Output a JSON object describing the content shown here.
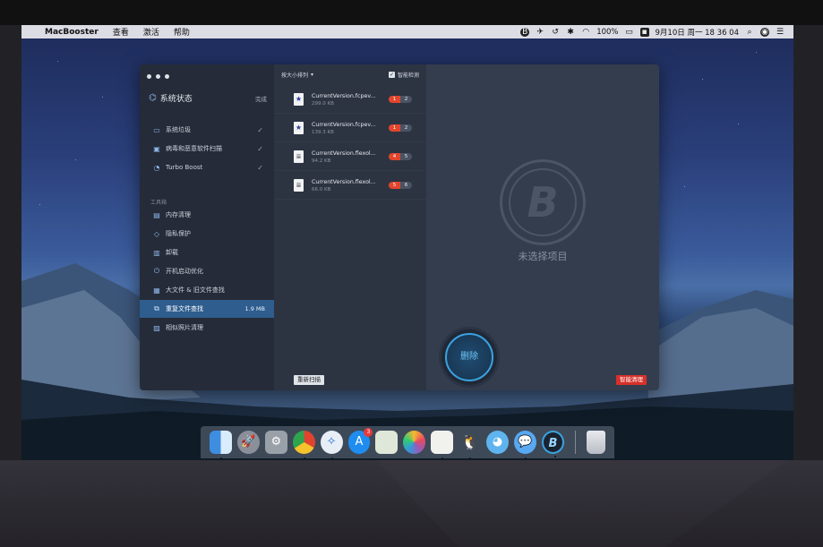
{
  "menubar": {
    "app_name": "MacBooster",
    "menus": [
      "查看",
      "激活",
      "帮助"
    ],
    "battery": "100%",
    "clock": "9月10日 周一 18 36 04"
  },
  "sidebar": {
    "title": "系统状态",
    "done_label": "完成",
    "scan_items": [
      {
        "label": "系统垃圾",
        "icon": "monitor-icon",
        "checked": true
      },
      {
        "label": "病毒和恶意软件扫描",
        "icon": "shield-monitor-icon",
        "checked": true
      },
      {
        "label": "Turbo Boost",
        "icon": "speed-icon",
        "checked": true
      }
    ],
    "tools_section": "工具箱",
    "tools": [
      {
        "label": "内存清理",
        "icon": "memory-icon"
      },
      {
        "label": "隐私保护",
        "icon": "privacy-shield-icon"
      },
      {
        "label": "卸载",
        "icon": "trash-icon"
      },
      {
        "label": "开机启动优化",
        "icon": "power-icon"
      },
      {
        "label": "大文件 & 旧文件查找",
        "icon": "folder-search-icon"
      },
      {
        "label": "重复文件查找",
        "icon": "duplicate-icon",
        "size": "1.9 MB",
        "active": true
      },
      {
        "label": "相似照片清理",
        "icon": "photo-icon"
      }
    ]
  },
  "list": {
    "sort_label": "按大小排列",
    "smart_label": "智能检测",
    "files": [
      {
        "name": "CurrentVersion.fcpev...",
        "size": "299.0 KB",
        "badge_red": "1",
        "badge_gray": "2"
      },
      {
        "name": "CurrentVersion.fcpev...",
        "size": "139.3 KB",
        "badge_red": "1",
        "badge_gray": "2"
      },
      {
        "name": "CurrentVersion.flexol...",
        "size": "94.2 KB",
        "badge_red": "4",
        "badge_gray": "5"
      },
      {
        "name": "CurrentVersion.flexol...",
        "size": "66.0 KB",
        "badge_red": "5",
        "badge_gray": "6"
      }
    ]
  },
  "detail": {
    "logo_letter": "B",
    "empty_label": "未选择项目"
  },
  "actions": {
    "rescan": "重新扫描",
    "delete": "删除",
    "smart_clean": "智能清理"
  },
  "dock": {
    "appstore_badge": "3"
  },
  "colors": {
    "accent": "#3aa3e0",
    "danger": "#d8302a",
    "active_item": "#2e5d8e"
  }
}
